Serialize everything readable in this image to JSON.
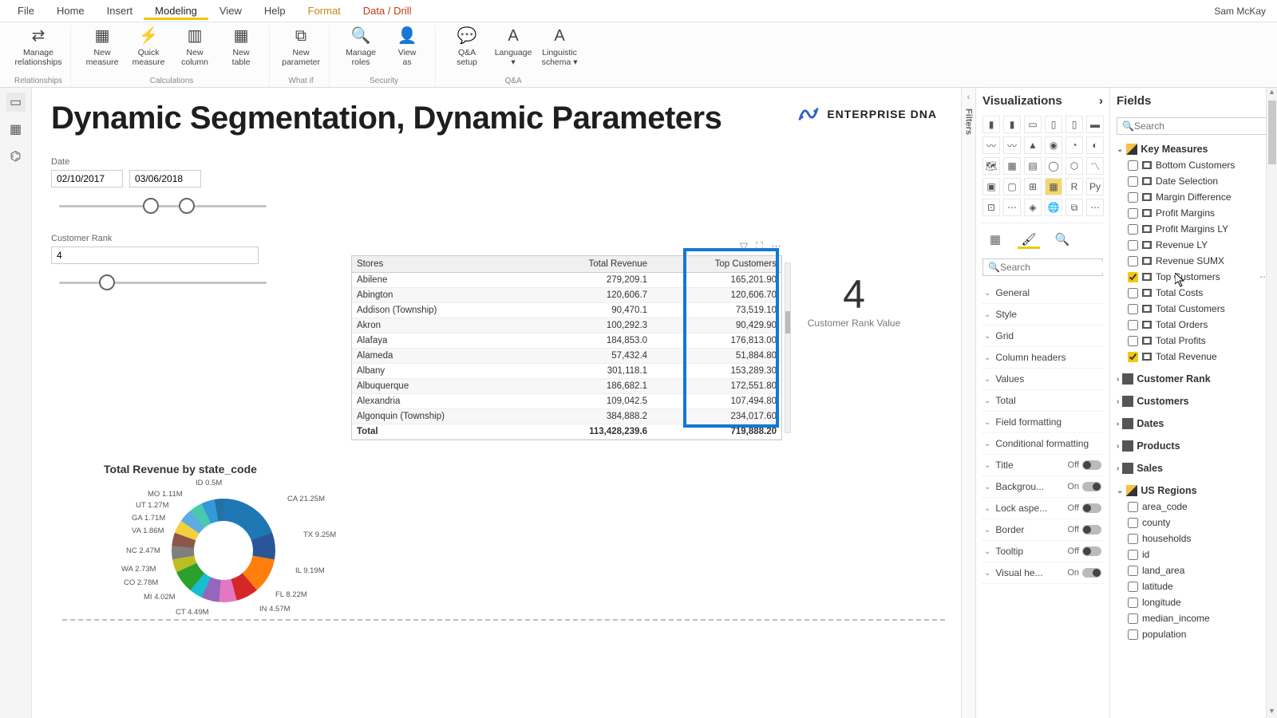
{
  "user": "Sam McKay",
  "menu": {
    "items": [
      "File",
      "Home",
      "Insert",
      "Modeling",
      "View",
      "Help",
      "Format",
      "Data / Drill"
    ],
    "active": 3,
    "format_color": "#C58A17",
    "drill_color": "#C53A17"
  },
  "ribbon": {
    "groups": [
      {
        "label": "Relationships",
        "buttons": [
          {
            "icon": "⇄",
            "text": "Manage relationships"
          }
        ]
      },
      {
        "label": "Calculations",
        "buttons": [
          {
            "icon": "▦",
            "text": "New measure"
          },
          {
            "icon": "⚡",
            "text": "Quick measure"
          },
          {
            "icon": "▥",
            "text": "New column"
          },
          {
            "icon": "▦",
            "text": "New table"
          }
        ]
      },
      {
        "label": "What if",
        "buttons": [
          {
            "icon": "⧉",
            "text": "New parameter"
          }
        ]
      },
      {
        "label": "Security",
        "buttons": [
          {
            "icon": "🔍",
            "text": "Manage roles"
          },
          {
            "icon": "👤",
            "text": "View as"
          }
        ]
      },
      {
        "label": "Q&A",
        "buttons": [
          {
            "icon": "💬",
            "text": "Q&A setup"
          },
          {
            "icon": "A",
            "text": "Language ▾"
          },
          {
            "icon": "A",
            "text": "Linguistic schema ▾"
          }
        ]
      }
    ]
  },
  "report": {
    "title": "Dynamic Segmentation, Dynamic Parameters",
    "logo_text": "ENTERPRISE DNA",
    "date": {
      "label": "Date",
      "from": "02/10/2017",
      "to": "03/06/2018"
    },
    "rank": {
      "label": "Customer Rank",
      "value": "4"
    },
    "card": {
      "value": "4",
      "label": "Customer Rank Value"
    }
  },
  "table": {
    "columns": [
      "Stores",
      "Total Revenue",
      "Top Customers"
    ],
    "rows": [
      [
        "Abilene",
        "279,209.1",
        "165,201.90"
      ],
      [
        "Abington",
        "120,606.7",
        "120,606.70"
      ],
      [
        "Addison (Township)",
        "90,470.1",
        "73,519.10"
      ],
      [
        "Akron",
        "100,292.3",
        "90,429.90"
      ],
      [
        "Alafaya",
        "184,853.0",
        "176,813.00"
      ],
      [
        "Alameda",
        "57,432.4",
        "51,884.80"
      ],
      [
        "Albany",
        "301,118.1",
        "153,289.30"
      ],
      [
        "Albuquerque",
        "186,682.1",
        "172,551.80"
      ],
      [
        "Alexandria",
        "109,042.5",
        "107,494.80"
      ],
      [
        "Algonquin (Township)",
        "384,888.2",
        "234,017.60"
      ]
    ],
    "total": [
      "Total",
      "113,428,239.6",
      "719,888.20"
    ]
  },
  "chart_data": {
    "type": "pie",
    "title": "Total Revenue by state_code",
    "slices": [
      {
        "label": "CA",
        "value": 21.25,
        "unit": "M"
      },
      {
        "label": "TX",
        "value": 9.25,
        "unit": "M"
      },
      {
        "label": "IL",
        "value": 9.19,
        "unit": "M"
      },
      {
        "label": "FL",
        "value": 8.22,
        "unit": "M"
      },
      {
        "label": "IN",
        "value": 4.57,
        "unit": "M"
      },
      {
        "label": "CT",
        "value": 4.49,
        "unit": "M"
      },
      {
        "label": "MI",
        "value": 4.02,
        "unit": "M"
      },
      {
        "label": "CO",
        "value": 2.78,
        "unit": "M"
      },
      {
        "label": "WA",
        "value": 2.73,
        "unit": "M"
      },
      {
        "label": "NC",
        "value": 2.47,
        "unit": "M"
      },
      {
        "label": "VA",
        "value": 1.86,
        "unit": "M"
      },
      {
        "label": "GA",
        "value": 1.71,
        "unit": "M"
      },
      {
        "label": "UT",
        "value": 1.27,
        "unit": "M"
      },
      {
        "label": "MO",
        "value": 1.11,
        "unit": "M"
      },
      {
        "label": "ID",
        "value": 0.5,
        "unit": "M"
      }
    ],
    "donut_labels": {
      "ca": "CA 21.25M",
      "tx": "TX 9.25M",
      "il": "IL 9.19M",
      "fl": "FL 8.22M",
      "in": "IN 4.57M",
      "ct": "CT 4.49M",
      "mi": "MI 4.02M",
      "co": "CO 2.78M",
      "wa": "WA 2.73M",
      "nc": "NC 2.47M",
      "va": "VA 1.86M",
      "ga": "GA 1.71M",
      "ut": "UT 1.27M",
      "mo": "MO 1.11M",
      "id": "ID 0.5M"
    }
  },
  "viz": {
    "header": "Visualizations",
    "search_placeholder": "Search",
    "format_groups": [
      {
        "name": "General"
      },
      {
        "name": "Style"
      },
      {
        "name": "Grid"
      },
      {
        "name": "Column headers"
      },
      {
        "name": "Values"
      },
      {
        "name": "Total"
      },
      {
        "name": "Field formatting"
      },
      {
        "name": "Conditional formatting"
      },
      {
        "name": "Title",
        "toggle": "Off"
      },
      {
        "name": "Backgrou...",
        "toggle": "On"
      },
      {
        "name": "Lock aspe...",
        "toggle": "Off"
      },
      {
        "name": "Border",
        "toggle": "Off"
      },
      {
        "name": "Tooltip",
        "toggle": "Off"
      },
      {
        "name": "Visual he...",
        "toggle": "On"
      }
    ]
  },
  "fields": {
    "header": "Fields",
    "search_placeholder": "Search",
    "tables": [
      {
        "name": "Key Measures",
        "type": "measure",
        "expanded": true,
        "fields": [
          {
            "name": "Bottom Customers",
            "checked": false,
            "calc": true
          },
          {
            "name": "Date Selection",
            "checked": false,
            "calc": true
          },
          {
            "name": "Margin Difference",
            "checked": false,
            "calc": true
          },
          {
            "name": "Profit Margins",
            "checked": false,
            "calc": true
          },
          {
            "name": "Profit Margins LY",
            "checked": false,
            "calc": true
          },
          {
            "name": "Revenue LY",
            "checked": false,
            "calc": true
          },
          {
            "name": "Revenue SUMX",
            "checked": false,
            "calc": true
          },
          {
            "name": "Top Customers",
            "checked": true,
            "calc": true,
            "cursor": true,
            "more": true
          },
          {
            "name": "Total Costs",
            "checked": false,
            "calc": true
          },
          {
            "name": "Total Customers",
            "checked": false,
            "calc": true
          },
          {
            "name": "Total Orders",
            "checked": false,
            "calc": true
          },
          {
            "name": "Total Profits",
            "checked": false,
            "calc": true
          },
          {
            "name": "Total Revenue",
            "checked": true,
            "calc": true
          }
        ]
      },
      {
        "name": "Customer Rank",
        "type": "table",
        "expanded": false
      },
      {
        "name": "Customers",
        "type": "table",
        "expanded": false
      },
      {
        "name": "Dates",
        "type": "table",
        "expanded": false
      },
      {
        "name": "Products",
        "type": "table",
        "expanded": false
      },
      {
        "name": "Sales",
        "type": "table",
        "expanded": false
      },
      {
        "name": "US Regions",
        "type": "measure",
        "expanded": true,
        "fields": [
          {
            "name": "area_code",
            "checked": false
          },
          {
            "name": "county",
            "checked": false
          },
          {
            "name": "households",
            "checked": false
          },
          {
            "name": "id",
            "checked": false
          },
          {
            "name": "land_area",
            "checked": false
          },
          {
            "name": "latitude",
            "checked": false
          },
          {
            "name": "longitude",
            "checked": false
          },
          {
            "name": "median_income",
            "checked": false
          },
          {
            "name": "population",
            "checked": false
          }
        ]
      }
    ]
  }
}
